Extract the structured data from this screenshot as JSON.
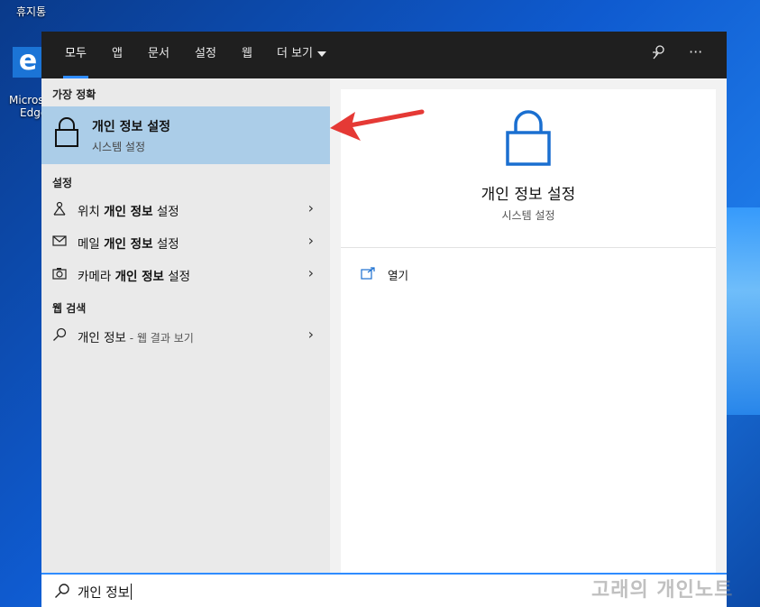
{
  "desktop": {
    "recycle_bin_label": "휴지통",
    "edge_label_1": "Micros",
    "edge_label_2": "Edge"
  },
  "tabs": [
    {
      "label": "모두",
      "active": true
    },
    {
      "label": "앱"
    },
    {
      "label": "문서"
    },
    {
      "label": "설정"
    },
    {
      "label": "웹"
    },
    {
      "label": "더 보기"
    }
  ],
  "icons": {
    "feedback": "feedback-icon",
    "more": "more-options-icon",
    "more_glyph": "···"
  },
  "best_match": {
    "section_title": "가장 정확",
    "title": "개인 정보 설정",
    "subtitle": "시스템 설정"
  },
  "settings": {
    "section_title": "설정",
    "items": [
      {
        "prefix": "위치 ",
        "bold": "개인 정보",
        "suffix": " 설정",
        "icon": "location-icon"
      },
      {
        "prefix": "메일 ",
        "bold": "개인 정보",
        "suffix": " 설정",
        "icon": "mail-icon"
      },
      {
        "prefix": "카메라 ",
        "bold": "개인 정보",
        "suffix": " 설정",
        "icon": "camera-icon"
      }
    ]
  },
  "web_search": {
    "section_title": "웹 검색",
    "query": "개인 정보",
    "hint": " - 웹 결과 보기"
  },
  "detail": {
    "title": "개인 정보 설정",
    "subtitle": "시스템 설정",
    "open_label": "열기"
  },
  "search": {
    "value": "개인 정보"
  },
  "watermark": "고래의 개인노트",
  "colors": {
    "accent": "#2f8cff",
    "selected": "#abcde8",
    "lock": "#1a6fd0",
    "arrow": "#e53935"
  }
}
